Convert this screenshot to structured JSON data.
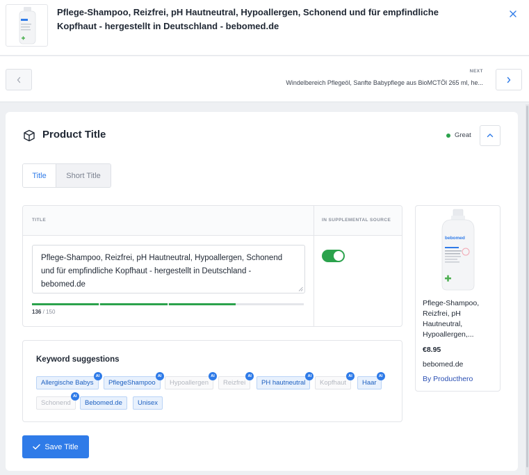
{
  "product": {
    "title": "Pflege-Shampoo, Reizfrei, pH Hautneutral, Hypoallergen, Schonend und für empfindliche Kopfhaut - hergestellt in Deutschland - bebomed.de",
    "thumbnail_icon": "shampoo-bottle-image"
  },
  "header": {
    "close_icon": "close-icon"
  },
  "pager": {
    "prev_icon": "chevron-left-icon",
    "next_icon": "chevron-right-icon",
    "next_label": "NEXT",
    "next_title": "Windelbereich Pflegeöl, Sanfte Babypflege aus BioMCTÖl 265 ml, he..."
  },
  "section": {
    "title": "Product Title",
    "icon": "box-icon",
    "status": "Great",
    "status_color": "#2ba24c",
    "collapse_icon": "chevron-up-icon"
  },
  "tabs": [
    {
      "label": "Title",
      "active": true
    },
    {
      "label": "Short Title",
      "active": false
    }
  ],
  "table": {
    "col_title": "TITLE",
    "col_supplemental": "IN SUPPLEMENTAL SOURCE",
    "title_value": "Pflege-Shampoo, Reizfrei, pH Hautneutral, Hypoallergen, Schonend und für empfindliche Kopfhaut - hergestellt in Deutschland - bebomed.de",
    "char_count": "136",
    "char_max": "/ 150",
    "progress_fraction": 0.75,
    "in_supplemental": true
  },
  "keywords": {
    "title": "Keyword suggestions",
    "ai_badge": "AI",
    "items": [
      {
        "label": "Allergische Babys",
        "selected": true,
        "ai": true
      },
      {
        "label": "PflegeShampoo",
        "selected": true,
        "ai": true
      },
      {
        "label": "Hypoallergen",
        "selected": false,
        "ai": true
      },
      {
        "label": "Reizfrei",
        "selected": false,
        "ai": true
      },
      {
        "label": "PH hautneutral",
        "selected": true,
        "ai": true
      },
      {
        "label": "Kopfhaut",
        "selected": false,
        "ai": true
      },
      {
        "label": "Haar",
        "selected": true,
        "ai": true
      },
      {
        "label": "Schonend",
        "selected": false,
        "ai": true
      },
      {
        "label": "Bebomed.de",
        "selected": true,
        "ai": false
      },
      {
        "label": "Unisex",
        "selected": true,
        "ai": false
      }
    ]
  },
  "save_button": {
    "label": "Save Title",
    "icon": "check-icon"
  },
  "preview": {
    "title": "Pflege-Shampoo, Reizfrei, pH Hautneutral, Hypoallergen,...",
    "price": "€8.95",
    "store": "bebomed.de",
    "by": "By Producthero",
    "bottle_label": "bebomed"
  },
  "colors": {
    "accent": "#2f7be8",
    "success": "#2ba24c"
  }
}
